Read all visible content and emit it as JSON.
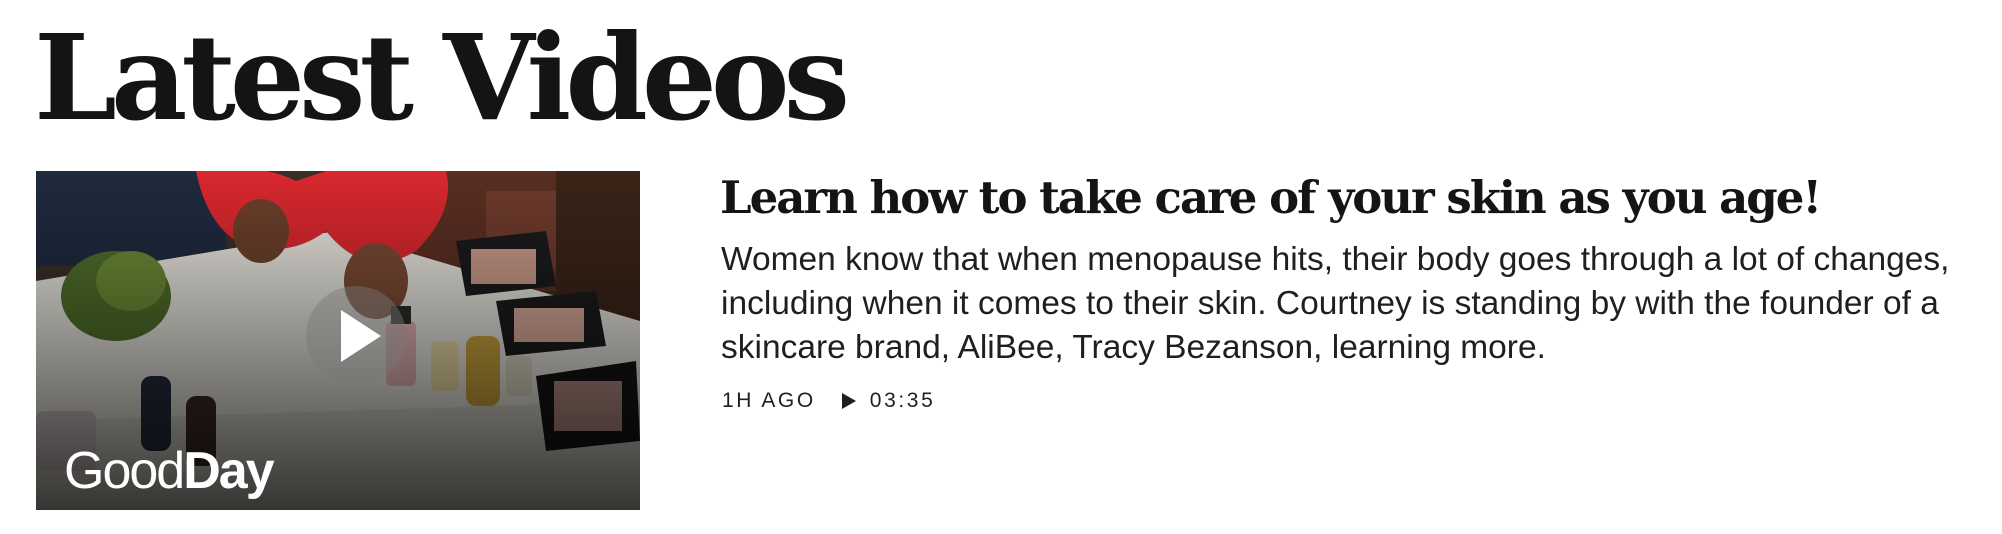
{
  "section": {
    "title": "Latest Videos"
  },
  "video": {
    "title": "Learn how to take care of your skin as you age!",
    "description": "Women know that when menopause hits, their body goes through a lot of changes, including when it comes to their skin. Courtney is standing by with the founder of a skincare brand, AliBee, Tracy Bezanson, learning more.",
    "time_ago": "1H AGO",
    "duration": "03:35",
    "thumbnail": {
      "brand_part1": "Good",
      "brand_part2": "Day"
    }
  }
}
